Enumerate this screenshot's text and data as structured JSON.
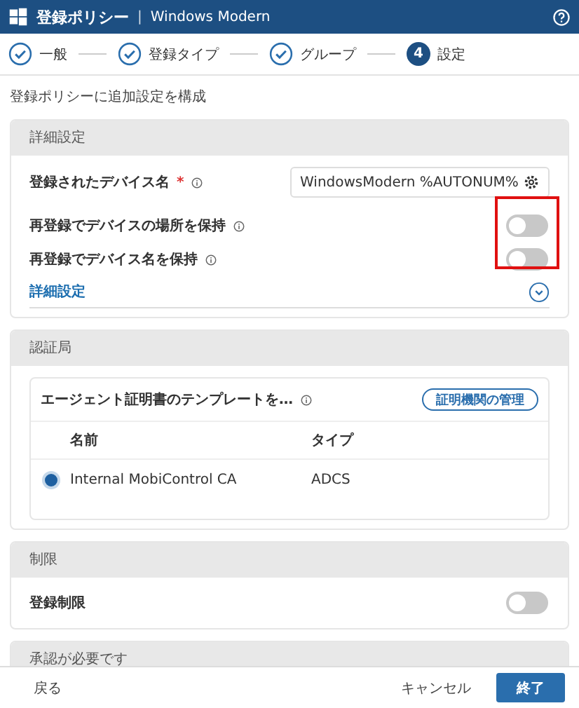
{
  "header": {
    "title": "登録ポリシー",
    "separator": "|",
    "subtitle": "Windows Modern"
  },
  "steps": [
    {
      "label": "一般",
      "done": true
    },
    {
      "label": "登録タイプ",
      "done": true
    },
    {
      "label": "グループ",
      "done": true
    },
    {
      "label": "設定",
      "done": false,
      "number": "4"
    }
  ],
  "intro": "登録ポリシーに追加設定を構成",
  "advanced": {
    "title": "詳細設定",
    "name_label": "登録されたデバイス名",
    "required_mark": "*",
    "name_value": "WindowsModern %AUTONUM%",
    "toggles": [
      {
        "label": "再登録でデバイスの場所を保持",
        "on": false
      },
      {
        "label": "再登録でデバイス名を保持",
        "on": false
      }
    ],
    "more_link": "詳細設定"
  },
  "authority": {
    "title": "認証局",
    "subtitle": "エージェント証明書のテンプレートを…",
    "manage_button": "証明機関の管理",
    "columns": [
      "名前",
      "タイプ"
    ],
    "rows": [
      {
        "name": "Internal MobiControl CA",
        "type": "ADCS",
        "selected": true
      }
    ]
  },
  "limits": {
    "title": "制限",
    "toggles": [
      {
        "label": "登録制限",
        "on": false
      }
    ]
  },
  "approval": {
    "title": "承認が必要です"
  },
  "footer": {
    "back": "戻る",
    "cancel": "キャンセル",
    "finish": "終了"
  }
}
